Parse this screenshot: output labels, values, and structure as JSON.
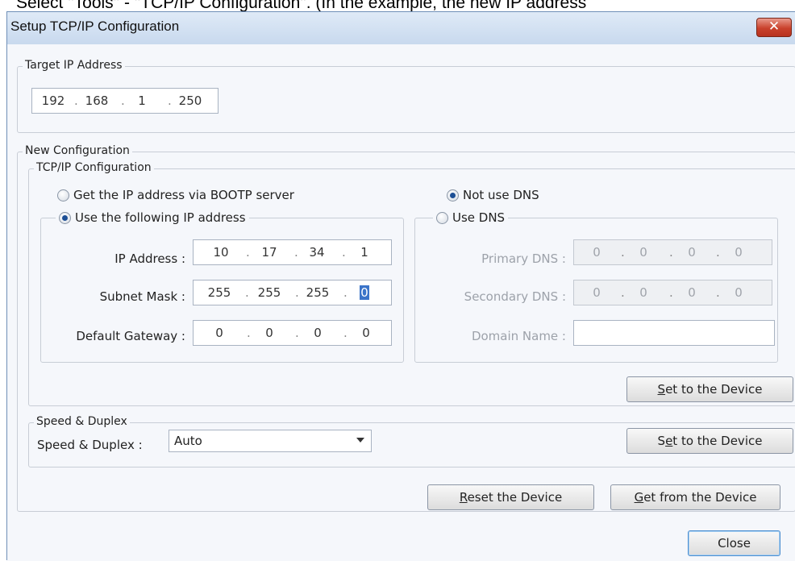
{
  "doc_caption": "Select \"Tools\" - \"TCP/IP Configuration\". (In the example, the new IP address",
  "window": {
    "title": "Setup TCP/IP Configuration",
    "close_glyph": "✕"
  },
  "target": {
    "legend": "Target IP Address",
    "ip": [
      "192",
      "168",
      "1",
      "250"
    ]
  },
  "new_config": {
    "legend": "New Configuration",
    "tcpip": {
      "legend": "TCP/IP Configuration",
      "radio_bootp": "Get the IP address via BOOTP server",
      "radio_static": "Use the following IP address",
      "ip_label": "IP Address :",
      "ip": [
        "10",
        "17",
        "34",
        "1"
      ],
      "subnet_label": "Subnet Mask :",
      "subnet": [
        "255",
        "255",
        "255",
        "0"
      ],
      "gateway_label": "Default Gateway :",
      "gateway": [
        "0",
        "0",
        "0",
        "0"
      ],
      "radio_no_dns": "Not use DNS",
      "radio_use_dns": "Use DNS",
      "primary_dns_label": "Primary DNS :",
      "primary_dns": [
        "0",
        "0",
        "0",
        "0"
      ],
      "secondary_dns_label": "Secondary DNS :",
      "secondary_dns": [
        "0",
        "0",
        "0",
        "0"
      ],
      "domain_label": "Domain Name :",
      "domain_value": "",
      "set_button": {
        "mnemonic": "S",
        "rest": "et to the Device"
      }
    },
    "speed": {
      "legend": "Speed & Duplex",
      "label": "Speed & Duplex :",
      "value": "Auto",
      "set_button": {
        "pre": "S",
        "mnemonic": "e",
        "rest": "t to the Device"
      }
    }
  },
  "buttons": {
    "reset": {
      "mnemonic": "R",
      "rest": "eset the Device"
    },
    "get": {
      "mnemonic": "G",
      "rest": "et from the Device"
    },
    "close": "Close"
  },
  "state": {
    "selected_ip_mode": "static",
    "selected_dns_mode": "no_dns"
  },
  "colors": {
    "accent": "#3b74c9",
    "close_button": "#c9412c",
    "titlebar": "#c8d9ee"
  }
}
